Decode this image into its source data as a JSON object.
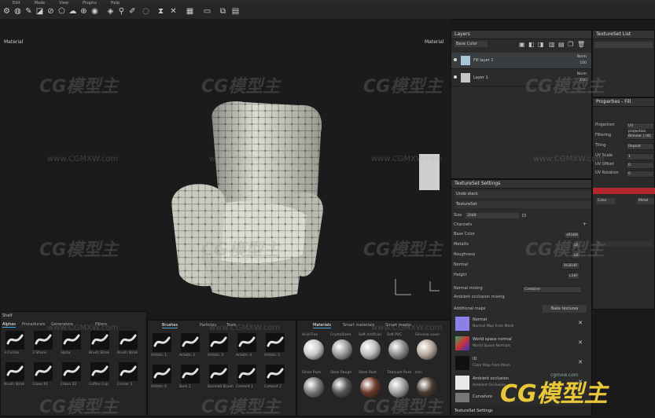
{
  "menubar": {
    "items": [
      "Edit",
      "Mode",
      "View",
      "Plugins",
      "Help"
    ]
  },
  "viewport": {
    "left_label": "Material",
    "right_label": "Material"
  },
  "layers_panel": {
    "title": "Layers",
    "channel_select": "Base Color",
    "layers": [
      {
        "name": "Fill layer 1",
        "blend": "Norm",
        "opacity": "100"
      },
      {
        "name": "Layer 1",
        "blend": "Norm",
        "opacity": "100"
      }
    ]
  },
  "textureset_list": {
    "title": "TextureSet List"
  },
  "properties": {
    "title": "Properties - Fill",
    "rows": [
      {
        "label": "Projection",
        "value": "UV projection"
      },
      {
        "label": "Filtering",
        "value": "Bilinear | HQ"
      },
      {
        "label": "Tiling",
        "value": "Repeat"
      },
      {
        "label": "UV Scale",
        "value": "1"
      },
      {
        "label": "UV Offset",
        "value": "0"
      },
      {
        "label": "UV Rotation",
        "value": "0"
      }
    ],
    "color_label": "Color",
    "metal_label": "Metal"
  },
  "textureset_settings": {
    "title": "TextureSet Settings",
    "shader": "Undo stack",
    "name": "TextureSet",
    "size_label": "Size",
    "size_value": "2048",
    "channels_label": "Channels",
    "channels": [
      {
        "label": "Base Color",
        "value": "sRGB8"
      },
      {
        "label": "Metallic",
        "value": "L8"
      },
      {
        "label": "Roughness",
        "value": "L8"
      },
      {
        "label": "Normal",
        "value": "RGB16F"
      },
      {
        "label": "Height",
        "value": "L16F"
      }
    ],
    "normal_mixing_label": "Normal mixing",
    "normal_mixing_value": "Combine",
    "ao_mixing_label": "Ambient occlusion mixing",
    "additional_maps_label": "Additional maps",
    "bake_button": "Bake textures",
    "maps": [
      {
        "title": "Normal",
        "sub": "Normal Map from Mesh",
        "color": "#8b7fe8"
      },
      {
        "title": "World space normal",
        "sub": "World Space Normals",
        "color": "#3b3b3b"
      },
      {
        "title": "ID",
        "sub": "Color Map from Mesh",
        "color": "#111111"
      },
      {
        "title": "Ambient occlusion",
        "sub": "Ambient Occlusion",
        "color": "#e8e8e8"
      },
      {
        "title": "Curvature",
        "sub": "Curvature",
        "color": "#777777"
      }
    ],
    "footer_tab": "TextureSet Settings"
  },
  "shelf_left": {
    "title": "Shelf",
    "tabs": [
      "Alphas",
      "Procedurals",
      "Generators",
      "Filters"
    ],
    "items": [
      "3 Circles",
      "3 Stains",
      "alpha",
      "Brush Strok",
      "Brush Strok",
      "Brush Strok",
      "Claws 01",
      "Claws 02",
      "Coffee Cup",
      "Corner 1"
    ]
  },
  "shelf_brushes": {
    "tabs": [
      "Brushes",
      "Particles",
      "Tools"
    ],
    "items": [
      "Artistic 1",
      "Artistic 2",
      "Artistic 3",
      "Artistic 4",
      "Artistic 5",
      "Artistic 6",
      "Bark 1",
      "Basmati Brush",
      "Cement 1",
      "Cement 2"
    ]
  },
  "shelf_materials": {
    "tabs": [
      "Materials",
      "Smart materials",
      "Smart masks"
    ],
    "items": [
      "Acid Fine",
      "Crystallized",
      "Soft Artificial",
      "Soft PVC",
      "Silicone cover",
      "Silver Pure",
      "Steel Rough",
      "Steel Rust",
      "Titanium Pure",
      "Iron"
    ]
  },
  "watermark": {
    "brand": "CG模型主",
    "url": "www.CGMXW.com",
    "url2": "cgmxw.com"
  }
}
